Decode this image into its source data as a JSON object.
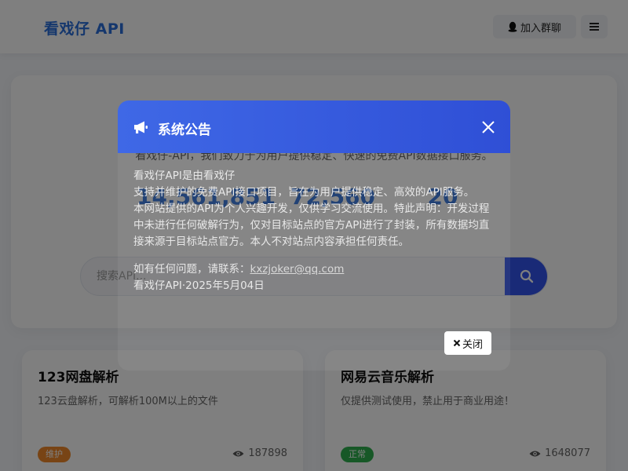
{
  "header": {
    "logo": "看戏仔 API",
    "join_group": "加入群聊",
    "join_icon": "qq-penguin-icon",
    "menu_icon": "hamburger-menu-icon"
  },
  "hero": {
    "description": "看戏仔-API，我们致力于为用户提供稳定、快速的免费API数据接口服务。",
    "stats": [
      {
        "value": "14,561,851"
      },
      {
        "value": "72,560"
      },
      {
        "value": "20"
      }
    ],
    "search": {
      "placeholder": "搜索API...",
      "button_icon": "search-icon"
    }
  },
  "cards": [
    {
      "title": "123网盘解析",
      "desc": "123云盘解析，可解析100M以上的文件",
      "status": "维护",
      "views": "187898"
    },
    {
      "title": "网易云音乐解析",
      "desc": "仅提供测试使用，禁止用于商业用途！",
      "status": "正常",
      "views": "1648077"
    }
  ],
  "modal": {
    "title": "系统公告",
    "title_icon": "megaphone-icon",
    "close_icon": "close-x-icon",
    "lines": [
      "看戏仔API是由看戏仔",
      "支持并维护的免费API接口项目，旨在为用户提供稳定、高效的API服务。",
      "本网站提供的API为个人兴趣开发，仅供学习交流使用。特此声明：开发过程中未进行任何破解行为，仅对目标站点的官方API进行了封装，所有数据均直接来源于目标站点官方。本人不对站点内容承担任何责任。"
    ],
    "contact_prefix": "如有任何问题，请联系：",
    "contact_email": "kxzjoker@qq.com",
    "signature": "看戏仔API·2025年5月04日",
    "close_button": "关闭"
  },
  "colors": {
    "primary": "#2a6fdb",
    "modal_header": "#3f68e6",
    "badge_maintenance": "#f0892b",
    "badge_normal": "#2fb14f"
  }
}
